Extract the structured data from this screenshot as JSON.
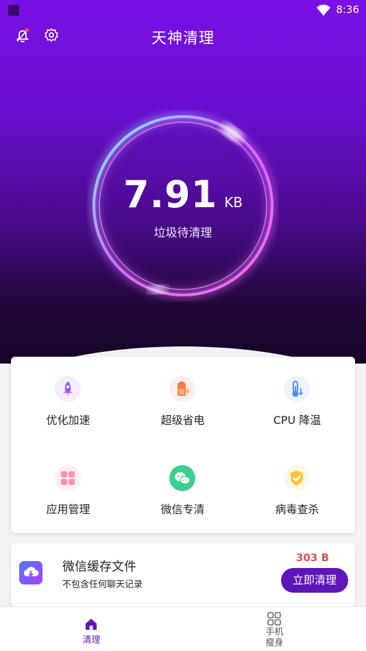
{
  "status_bar": {
    "time": "8:36"
  },
  "header": {
    "title": "天神清理",
    "icons": [
      "bell-off-icon",
      "gear-icon"
    ]
  },
  "ring": {
    "value": "7.91",
    "unit": "KB",
    "label": "垃圾待清理"
  },
  "tools": [
    {
      "label": "优化加速",
      "icon": "rocket-icon"
    },
    {
      "label": "超级省电",
      "icon": "battery-icon"
    },
    {
      "label": "CPU 降温",
      "icon": "thermometer-icon"
    },
    {
      "label": "应用管理",
      "icon": "apps-grid-icon"
    },
    {
      "label": "微信专清",
      "icon": "wechat-icon"
    },
    {
      "label": "病毒查杀",
      "icon": "shield-check-icon"
    }
  ],
  "wechat_card": {
    "title": "微信缓存文件",
    "subtitle": "不包含任何聊天记录",
    "size": "303 B",
    "button": "立即清理"
  },
  "tabbar": {
    "items": [
      {
        "label": "清理",
        "active": true
      },
      {
        "label": "手机\n瘦身",
        "active": false
      }
    ]
  },
  "colors": {
    "accent": "#5e16b8",
    "hero_top": "#7a10e6",
    "hero_bottom": "#150526",
    "size_red": "#d9534f"
  }
}
